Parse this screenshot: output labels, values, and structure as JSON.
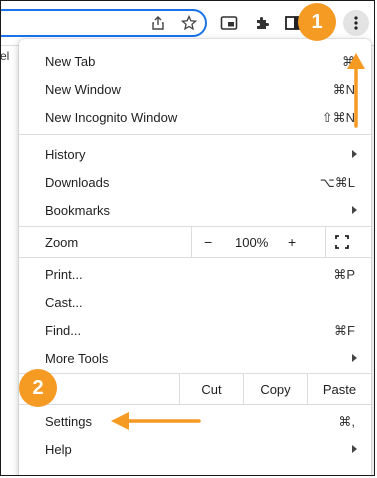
{
  "toolbar": {
    "icons": [
      "share-icon",
      "star-icon",
      "picture-in-picture-icon",
      "extensions-icon",
      "side-panel-icon",
      "kebab-menu-icon"
    ]
  },
  "bookmarks_bar": {
    "fragment": "el"
  },
  "menu": {
    "new_tab": {
      "label": "New Tab",
      "shortcut": "⌘"
    },
    "new_window": {
      "label": "New Window",
      "shortcut": "⌘N"
    },
    "new_incognito": {
      "label": "New Incognito Window",
      "shortcut": "⇧⌘N"
    },
    "history": {
      "label": "History"
    },
    "downloads": {
      "label": "Downloads",
      "shortcut": "⌥⌘L"
    },
    "bookmarks": {
      "label": "Bookmarks"
    },
    "zoom": {
      "label": "Zoom",
      "minus": "−",
      "level": "100%",
      "plus": "+",
      "fullscreen_icon": "fullscreen-icon"
    },
    "print": {
      "label": "Print...",
      "shortcut": "⌘P"
    },
    "cast": {
      "label": "Cast..."
    },
    "find": {
      "label": "Find...",
      "shortcut": "⌘F"
    },
    "more_tools": {
      "label": "More Tools"
    },
    "edit": {
      "label": "t",
      "cut": "Cut",
      "copy": "Copy",
      "paste": "Paste"
    },
    "settings": {
      "label": "Settings",
      "shortcut": "⌘,"
    },
    "help": {
      "label": "Help"
    }
  },
  "callouts": {
    "step1": "1",
    "step2": "2",
    "color": "#f59a23"
  }
}
